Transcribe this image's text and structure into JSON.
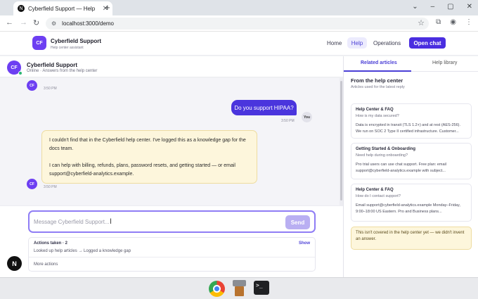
{
  "browser": {
    "tab_title": "Cyberfield Support — Help",
    "tab_favicon_letter": "N",
    "url": "localhost:3000/demo",
    "new_tab_glyph": "+",
    "close_glyph": "✕"
  },
  "app": {
    "logo_initials": "CF",
    "brand_title": "Cyberfield Support",
    "brand_subtitle": "Help center assistant",
    "nav": {
      "home": "Home",
      "help": "Help",
      "operations": "Operations"
    },
    "open_chat_label": "Open chat"
  },
  "chat": {
    "avatar_initials": "CF",
    "title": "Cyberfield Support",
    "status": "Online · Answers from the help center",
    "messages": {
      "earlier_time": "3:50 PM",
      "user_text": "Do you support HIPAA?",
      "user_time": "3:50 PM",
      "user_badge": "You",
      "bot_para1": "I couldn't find that in the Cyberfield help center. I've logged this as a knowledge gap for the docs team.",
      "bot_para2": "I can help with billing, refunds, plans, password resets, and getting started — or email support@cyberfield-analytics.example.",
      "bot_time": "3:50 PM"
    },
    "composer": {
      "placeholder": "Message Cyberfield Support...",
      "send_label": "Send"
    },
    "actions": {
      "title": "Actions taken · 2",
      "show_label": "Show",
      "detail": "Looked up help articles → Logged a knowledge gap",
      "more_label": "More actions"
    }
  },
  "sidebar": {
    "tabs": {
      "related": "Related articles",
      "library": "Help library"
    },
    "heading": "From the help center",
    "subheading": "Articles used for the latest reply",
    "articles": [
      {
        "category": "Help Center & FAQ",
        "question": "How is my data secured?",
        "excerpt": "Data is encrypted in transit (TLS 1.2+) and at rest (AES-256). We run on SOC 2 Type II certified infrastructure. Customer..."
      },
      {
        "category": "Getting Started & Onboarding",
        "question": "Need help during onboarding?",
        "excerpt": "Pro trial users can use chat support. Free plan: email support@cyberfield-analytics.example with subject..."
      },
      {
        "category": "Help Center & FAQ",
        "question": "How do I contact support?",
        "excerpt": "Email support@cyberfield-analytics.example Monday–Friday, 9:00–18:00 US Eastern. Pro and Business plans..."
      }
    ],
    "notice": "This isn't covered in the help center yet — we didn't invent an answer."
  },
  "misc": {
    "corner_badge": "N"
  }
}
